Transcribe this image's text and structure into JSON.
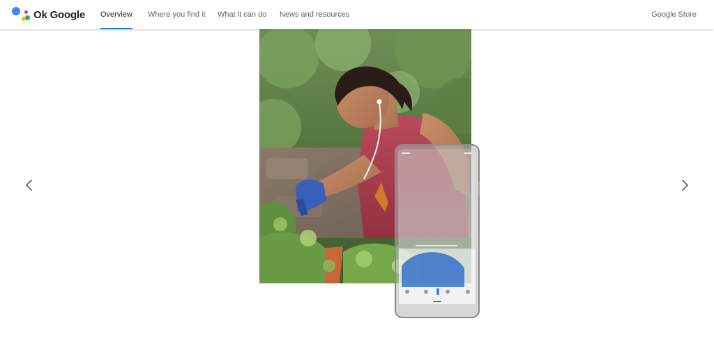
{
  "header": {
    "brand_name": "Ok Google",
    "nav_items": [
      {
        "label": "Overview",
        "active": true
      },
      {
        "label": "Where you find it",
        "active": false
      },
      {
        "label": "What it can do",
        "active": false
      },
      {
        "label": "News and resources",
        "active": false
      }
    ],
    "store_label": "Google Store"
  },
  "colors": {
    "accent": "#1a73e8",
    "logo_blue": "#4285f4",
    "logo_red": "#ea4335",
    "logo_yellow": "#fbbc04",
    "logo_green": "#34a853"
  },
  "carousel": {
    "prev_icon": "chevron-left-icon",
    "next_icon": "chevron-right-icon",
    "image_subject": "woman gardening with earphones",
    "overlay": "phone-mockup-transparent"
  }
}
